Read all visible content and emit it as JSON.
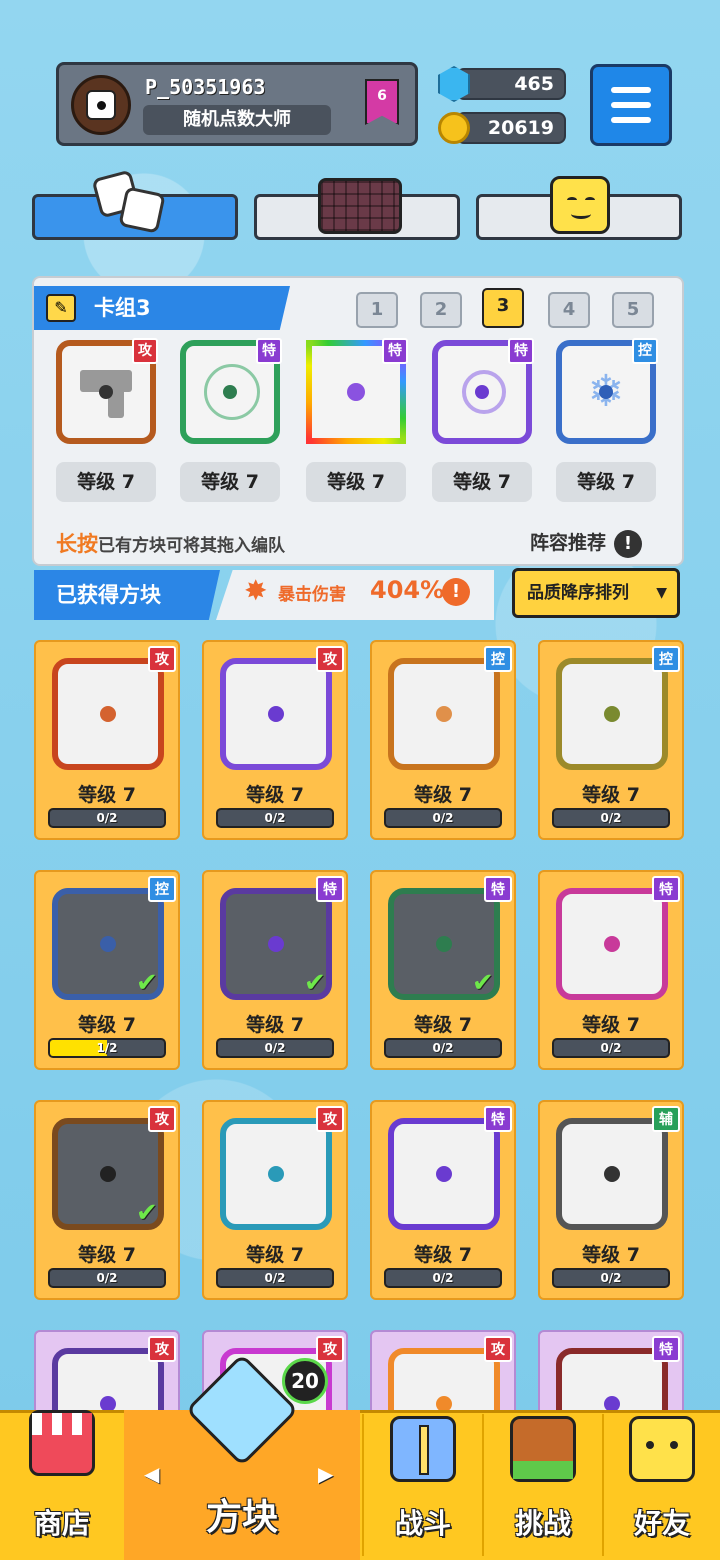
{
  "player": {
    "id": "P_50351963",
    "title": "随机点数大师",
    "rank": "6",
    "gems": "465",
    "coins": "20619"
  },
  "deck": {
    "name": "卡组3",
    "tabs": [
      "1",
      "2",
      "3",
      "4",
      "5"
    ],
    "selected_tab": "3",
    "slots": [
      {
        "level": "等级 7",
        "tag": "攻"
      },
      {
        "level": "等级 7",
        "tag": "特"
      },
      {
        "level": "等级 7",
        "tag": "特"
      },
      {
        "level": "等级 7",
        "tag": "特"
      },
      {
        "level": "等级 7",
        "tag": "控"
      }
    ],
    "hint_highlight": "长按",
    "hint_text": "已有方块可将其拖入编队",
    "recommend": "阵容推荐",
    "recommend_icon": "!"
  },
  "owned": {
    "label": "已获得方块",
    "crit_label": "暴击伤害",
    "crit_value": "404%",
    "crit_icon": "!",
    "sort_label": "品质降序排列",
    "sort_arrow": "▼",
    "cards": [
      {
        "tag": "攻",
        "level": "等级 7",
        "progress": "0/2",
        "fill": 0,
        "equipped": false
      },
      {
        "tag": "攻",
        "level": "等级 7",
        "progress": "0/2",
        "fill": 0,
        "equipped": false
      },
      {
        "tag": "控",
        "level": "等级 7",
        "progress": "0/2",
        "fill": 0,
        "equipped": false
      },
      {
        "tag": "控",
        "level": "等级 7",
        "progress": "0/2",
        "fill": 0,
        "equipped": false
      },
      {
        "tag": "控",
        "level": "等级 7",
        "progress": "1/2",
        "fill": 0.5,
        "equipped": true
      },
      {
        "tag": "特",
        "level": "等级 7",
        "progress": "0/2",
        "fill": 0,
        "equipped": true
      },
      {
        "tag": "特",
        "level": "等级 7",
        "progress": "0/2",
        "fill": 0,
        "equipped": true
      },
      {
        "tag": "特",
        "level": "等级 7",
        "progress": "0/2",
        "fill": 0,
        "equipped": false
      },
      {
        "tag": "攻",
        "level": "等级 7",
        "progress": "0/2",
        "fill": 0,
        "equipped": true
      },
      {
        "tag": "攻",
        "level": "等级 7",
        "progress": "0/2",
        "fill": 0,
        "equipped": false
      },
      {
        "tag": "特",
        "level": "等级 7",
        "progress": "0/2",
        "fill": 0,
        "equipped": false
      },
      {
        "tag": "辅",
        "level": "等级 7",
        "progress": "0/2",
        "fill": 0,
        "equipped": false
      },
      {
        "tag": "攻"
      },
      {
        "tag": "攻"
      },
      {
        "tag": "攻"
      },
      {
        "tag": "特"
      }
    ]
  },
  "nav": {
    "shop": "商店",
    "blocks": "方块",
    "battle": "战斗",
    "challenge": "挑战",
    "friends": "好友",
    "blocks_badge": "20",
    "arrow_left": "◀",
    "arrow_right": "▶"
  },
  "colors": {
    "accent_blue": "#2b86e6",
    "card_gold": "#ffc04a",
    "nav_yellow": "#ffc821",
    "crit_orange": "#ef6a2a"
  }
}
